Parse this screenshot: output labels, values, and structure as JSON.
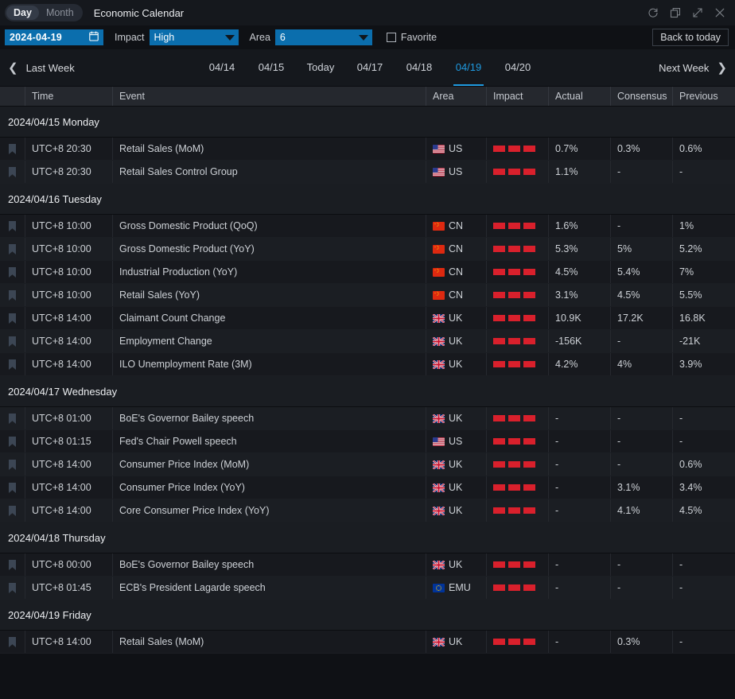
{
  "titlebar": {
    "view_toggle": [
      {
        "label": "Day",
        "active": true
      },
      {
        "label": "Month",
        "active": false
      }
    ],
    "app_title": "Economic Calendar",
    "window_controls": [
      {
        "name": "refresh-icon"
      },
      {
        "name": "restore-icon"
      },
      {
        "name": "expand-icon"
      },
      {
        "name": "close-icon"
      }
    ]
  },
  "filterbar": {
    "date_value": "2024-04-19",
    "calendar_icon": "calendar-icon",
    "impact_label": "Impact",
    "impact_value": "High",
    "area_label": "Area",
    "area_value": "6",
    "favorite_label": "Favorite",
    "favorite_checked": false,
    "back_to_today": "Back to today"
  },
  "datenav": {
    "last_week": "Last Week",
    "next_week": "Next Week",
    "tabs": [
      {
        "label": "04/14",
        "active": false
      },
      {
        "label": "04/15",
        "active": false
      },
      {
        "label": "Today",
        "active": false
      },
      {
        "label": "04/17",
        "active": false
      },
      {
        "label": "04/18",
        "active": false
      },
      {
        "label": "04/19",
        "active": true
      },
      {
        "label": "04/20",
        "active": false
      }
    ]
  },
  "table": {
    "columns": [
      "",
      "Time",
      "Event",
      "Area",
      "Impact",
      "Actual",
      "Consensus",
      "Previous"
    ],
    "groups": [
      {
        "date_label": "2024/04/15 Monday",
        "rows": [
          {
            "time": "UTC+8 20:30",
            "event": "Retail Sales (MoM)",
            "area": "US",
            "flag": "us-flag-icon",
            "impact": 3,
            "actual": "0.7%",
            "consensus": "0.3%",
            "previous": "0.6%"
          },
          {
            "time": "UTC+8 20:30",
            "event": "Retail Sales Control Group",
            "area": "US",
            "flag": "us-flag-icon",
            "impact": 3,
            "actual": "1.1%",
            "consensus": "-",
            "previous": "-"
          }
        ]
      },
      {
        "date_label": "2024/04/16 Tuesday",
        "rows": [
          {
            "time": "UTC+8 10:00",
            "event": "Gross Domestic Product (QoQ)",
            "area": "CN",
            "flag": "cn-flag-icon",
            "impact": 3,
            "actual": "1.6%",
            "consensus": "-",
            "previous": "1%"
          },
          {
            "time": "UTC+8 10:00",
            "event": "Gross Domestic Product (YoY)",
            "area": "CN",
            "flag": "cn-flag-icon",
            "impact": 3,
            "actual": "5.3%",
            "consensus": "5%",
            "previous": "5.2%"
          },
          {
            "time": "UTC+8 10:00",
            "event": "Industrial Production (YoY)",
            "area": "CN",
            "flag": "cn-flag-icon",
            "impact": 3,
            "actual": "4.5%",
            "consensus": "5.4%",
            "previous": "7%"
          },
          {
            "time": "UTC+8 10:00",
            "event": "Retail Sales (YoY)",
            "area": "CN",
            "flag": "cn-flag-icon",
            "impact": 3,
            "actual": "3.1%",
            "consensus": "4.5%",
            "previous": "5.5%"
          },
          {
            "time": "UTC+8 14:00",
            "event": "Claimant Count Change",
            "area": "UK",
            "flag": "uk-flag-icon",
            "impact": 3,
            "actual": "10.9K",
            "consensus": "17.2K",
            "previous": "16.8K"
          },
          {
            "time": "UTC+8 14:00",
            "event": "Employment Change",
            "area": "UK",
            "flag": "uk-flag-icon",
            "impact": 3,
            "actual": "-156K",
            "consensus": "-",
            "previous": "-21K"
          },
          {
            "time": "UTC+8 14:00",
            "event": "ILO Unemployment Rate (3M)",
            "area": "UK",
            "flag": "uk-flag-icon",
            "impact": 3,
            "actual": "4.2%",
            "consensus": "4%",
            "previous": "3.9%"
          }
        ]
      },
      {
        "date_label": "2024/04/17 Wednesday",
        "rows": [
          {
            "time": "UTC+8 01:00",
            "event": "BoE's Governor Bailey speech",
            "area": "UK",
            "flag": "uk-flag-icon",
            "impact": 3,
            "actual": "-",
            "consensus": "-",
            "previous": "-"
          },
          {
            "time": "UTC+8 01:15",
            "event": "Fed's Chair Powell speech",
            "area": "US",
            "flag": "us-flag-icon",
            "impact": 3,
            "actual": "-",
            "consensus": "-",
            "previous": "-"
          },
          {
            "time": "UTC+8 14:00",
            "event": "Consumer Price Index (MoM)",
            "area": "UK",
            "flag": "uk-flag-icon",
            "impact": 3,
            "actual": "-",
            "consensus": "-",
            "previous": "0.6%"
          },
          {
            "time": "UTC+8 14:00",
            "event": "Consumer Price Index (YoY)",
            "area": "UK",
            "flag": "uk-flag-icon",
            "impact": 3,
            "actual": "-",
            "consensus": "3.1%",
            "previous": "3.4%"
          },
          {
            "time": "UTC+8 14:00",
            "event": "Core Consumer Price Index (YoY)",
            "area": "UK",
            "flag": "uk-flag-icon",
            "impact": 3,
            "actual": "-",
            "consensus": "4.1%",
            "previous": "4.5%"
          }
        ]
      },
      {
        "date_label": "2024/04/18 Thursday",
        "rows": [
          {
            "time": "UTC+8 00:00",
            "event": "BoE's Governor Bailey speech",
            "area": "UK",
            "flag": "uk-flag-icon",
            "impact": 3,
            "actual": "-",
            "consensus": "-",
            "previous": "-"
          },
          {
            "time": "UTC+8 01:45",
            "event": "ECB's President Lagarde speech",
            "area": "EMU",
            "flag": "emu-flag-icon",
            "impact": 3,
            "actual": "-",
            "consensus": "-",
            "previous": "-"
          }
        ]
      },
      {
        "date_label": "2024/04/19 Friday",
        "rows": [
          {
            "time": "UTC+8 14:00",
            "event": "Retail Sales (MoM)",
            "area": "UK",
            "flag": "uk-flag-icon",
            "impact": 3,
            "actual": "-",
            "consensus": "0.3%",
            "previous": "-"
          }
        ]
      }
    ]
  },
  "colors": {
    "accent_blue": "#0b6ead",
    "active_tab": "#1f9ae0",
    "impact_red": "#d9202c",
    "panel_bg": "#0f1115",
    "header_bg": "#25282e"
  }
}
